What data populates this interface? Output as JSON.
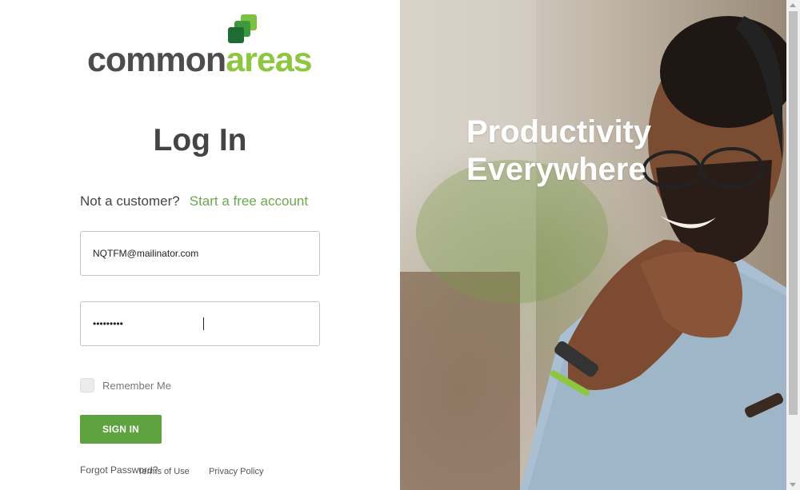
{
  "brand": {
    "logo_text_part1": "common",
    "logo_text_part2": "areas",
    "icon": "stacked-squares-logo-icon",
    "colors": {
      "dark_grey": "#4d4d4f",
      "green": "#8dc63f",
      "accent": "#5ea340"
    }
  },
  "login": {
    "title": "Log In",
    "not_customer_text": "Not a customer?",
    "free_account_link": "Start a free account",
    "email_value": "NQTFM@mailinator.com",
    "password_value": "•••••••••",
    "remember_label": "Remember Me",
    "signin_label": "SIGN IN",
    "forgot_password": "Forgot Password?"
  },
  "footer": {
    "terms": "Terms of Use",
    "privacy": "Privacy Policy"
  },
  "hero": {
    "line1": "Productivity",
    "line2": "Everywhere"
  }
}
